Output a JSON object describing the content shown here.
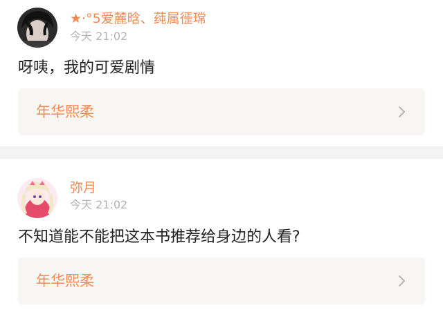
{
  "posts": [
    {
      "author": {
        "star_icon": "star-icon",
        "name": "·°5爱麓晗、莼属徰瑺",
        "avatar": "dark-haired-person-avatar"
      },
      "time": "今天 21:02",
      "text": "呀咦，我的可爱剧情",
      "book": {
        "title": "年华熙柔",
        "arrow_icon": "chevron-right-icon"
      }
    },
    {
      "author": {
        "name": "弥月",
        "avatar": "anime-girl-avatar"
      },
      "time": "今天 21:02",
      "text": "不知道能不能把这本书推荐给身边的人看?",
      "book": {
        "title": "年华熙柔",
        "arrow_icon": "chevron-right-icon"
      }
    }
  ],
  "colors": {
    "accent": "#ef8a55",
    "timestamp": "#b3b3b3",
    "body_text": "#222222",
    "card_bg": "#f7f6f2",
    "separator": "#f3f3f3"
  }
}
